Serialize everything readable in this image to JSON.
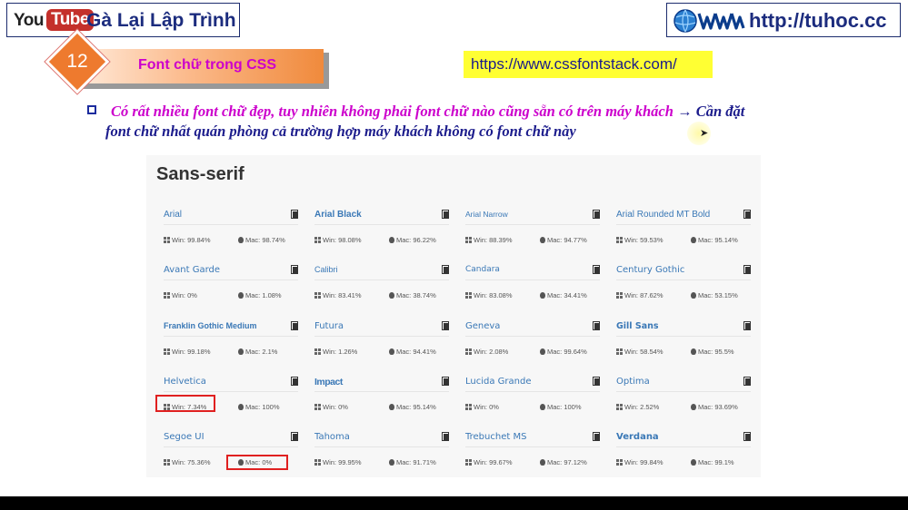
{
  "header": {
    "youtube_you": "You",
    "youtube_tube": "Tube",
    "channel": "Gà Lại Lập Trình",
    "site_url": "http://tuhoc.cc"
  },
  "lesson": {
    "number": "12",
    "title": "Font chữ trong CSS",
    "link": "https://www.cssfontstack.com/"
  },
  "description": {
    "line1_part1": "Có rất nhiều font chữ đẹp, tuy nhiên không phải font chữ nào cũng sẵn có trên máy khách ",
    "arrow": "→",
    "line1_part2": " Cần đặt",
    "line2": "font chữ nhất quán phòng cả trường hợp máy khách không có font chữ này"
  },
  "panel": {
    "title": "Sans-serif",
    "fonts": [
      [
        {
          "name": "Arial",
          "win": "Win: 99.84%",
          "mac": "Mac: 98.74%"
        },
        {
          "name": "Arial Black",
          "win": "Win: 98.08%",
          "mac": "Mac: 96.22%"
        },
        {
          "name": "Arial Narrow",
          "win": "Win: 88.39%",
          "mac": "Mac: 94.77%"
        },
        {
          "name": "Arial Rounded MT Bold",
          "win": "Win: 59.53%",
          "mac": "Mac: 95.14%"
        }
      ],
      [
        {
          "name": "Avant Garde",
          "win": "Win: 0%",
          "mac": "Mac: 1.08%"
        },
        {
          "name": "Calibri",
          "win": "Win: 83.41%",
          "mac": "Mac: 38.74%"
        },
        {
          "name": "Candara",
          "win": "Win: 83.08%",
          "mac": "Mac: 34.41%"
        },
        {
          "name": "Century Gothic",
          "win": "Win: 87.62%",
          "mac": "Mac: 53.15%"
        }
      ],
      [
        {
          "name": "Franklin Gothic Medium",
          "win": "Win: 99.18%",
          "mac": "Mac: 2.1%"
        },
        {
          "name": "Futura",
          "win": "Win: 1.26%",
          "mac": "Mac: 94.41%"
        },
        {
          "name": "Geneva",
          "win": "Win: 2.08%",
          "mac": "Mac: 99.64%"
        },
        {
          "name": "Gill Sans",
          "win": "Win: 58.54%",
          "mac": "Mac: 95.5%"
        }
      ],
      [
        {
          "name": "Helvetica",
          "win": "Win: 7.34%",
          "mac": "Mac: 100%"
        },
        {
          "name": "Impact",
          "win": "Win: 0%",
          "mac": "Mac: 95.14%"
        },
        {
          "name": "Lucida Grande",
          "win": "Win: 0%",
          "mac": "Mac: 100%"
        },
        {
          "name": "Optima",
          "win": "Win: 2.52%",
          "mac": "Mac: 93.69%"
        }
      ],
      [
        {
          "name": "Segoe UI",
          "win": "Win: 75.36%",
          "mac": "Mac: 0%"
        },
        {
          "name": "Tahoma",
          "win": "Win: 99.95%",
          "mac": "Mac: 91.71%"
        },
        {
          "name": "Trebuchet MS",
          "win": "Win: 99.67%",
          "mac": "Mac: 97.12%"
        },
        {
          "name": "Verdana",
          "win": "Win: 99.84%",
          "mac": "Mac: 99.1%"
        }
      ]
    ]
  },
  "colors": {
    "brand_blue": "#1c2c7e",
    "accent_magenta": "#cc00cc",
    "ribbon_orange": "#ee7a2e",
    "link_highlight": "#ffff33",
    "font_link": "#3a78b6",
    "highlight_red": "#e02020"
  }
}
